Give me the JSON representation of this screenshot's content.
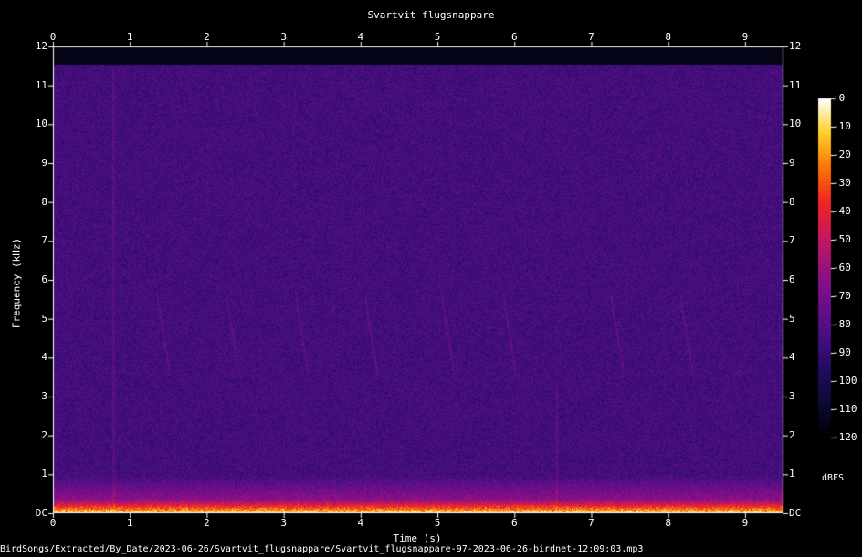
{
  "chart_data": {
    "type": "heatmap",
    "title": "Svartvit flugsnappare",
    "xlabel": "Time (s)",
    "ylabel": "Frequency (kHz)",
    "xlim": [
      0,
      9.5
    ],
    "ylim": [
      0,
      12
    ],
    "x_ticks": [
      "0",
      "1",
      "2",
      "3",
      "4",
      "5",
      "6",
      "7",
      "8",
      "9"
    ],
    "y_ticks": [
      "DC",
      "1",
      "2",
      "3",
      "4",
      "5",
      "6",
      "7",
      "8",
      "9",
      "10",
      "11",
      "12"
    ],
    "colorbar": {
      "label": "dBFS",
      "ticks": [
        "+0",
        "-10",
        "-20",
        "-30",
        "-40",
        "-50",
        "-60",
        "-70",
        "-80",
        "-90",
        "-100",
        "-110",
        "-120"
      ],
      "range": [
        -120,
        0
      ]
    },
    "calls_seconds": [
      1.4,
      2.3,
      3.2,
      4.1,
      5.1,
      5.9,
      7.3,
      8.2
    ],
    "footer": "BirdSongs/Extracted/By_Date/2023-06-26/Svartvit_flugsnappare/Svartvit_flugsnappare-97-2023-06-26-birdnet-12:09:03.mp3"
  }
}
